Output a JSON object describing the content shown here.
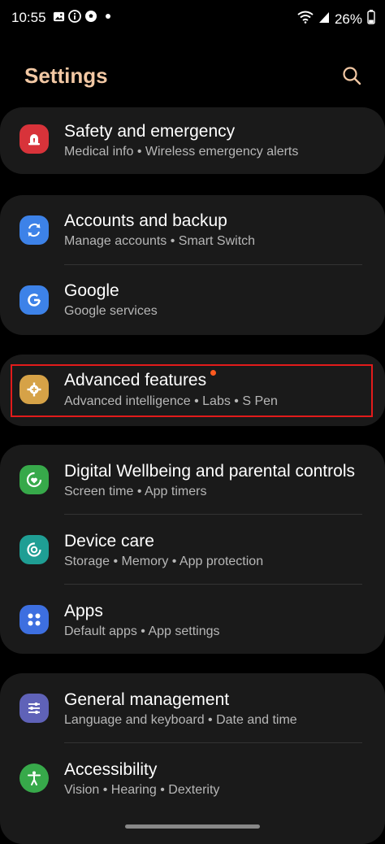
{
  "status_bar": {
    "time": "10:55",
    "battery": "26%",
    "notification_icons": [
      "gallery-icon",
      "info-icon",
      "soccer-icon"
    ]
  },
  "header": {
    "title": "Settings"
  },
  "items": [
    {
      "title": "Safety and emergency",
      "subtitle": "Medical info • Wireless emergency alerts",
      "icon": "siren-icon",
      "color": "#d8333a"
    },
    {
      "title": "Accounts and backup",
      "subtitle": "Manage accounts • Smart Switch",
      "icon": "sync-icon",
      "color": "#3d82e8"
    },
    {
      "title": "Google",
      "subtitle": "Google services",
      "icon": "google-icon",
      "color": "#3d82e8"
    },
    {
      "title": "Advanced features",
      "subtitle": "Advanced intelligence • Labs • S Pen",
      "icon": "gear-plus-icon",
      "color": "#d6a247"
    },
    {
      "title": "Digital Wellbeing and parental controls",
      "subtitle": "Screen time • App timers",
      "icon": "wellbeing-icon",
      "color": "#37a94a"
    },
    {
      "title": "Device care",
      "subtitle": "Storage • Memory • App protection",
      "icon": "device-care-icon",
      "color": "#1f9e94"
    },
    {
      "title": "Apps",
      "subtitle": "Default apps • App settings",
      "icon": "apps-icon",
      "color": "#3d6fe0"
    },
    {
      "title": "General management",
      "subtitle": "Language and keyboard • Date and time",
      "icon": "sliders-icon",
      "color": "#5f62b8"
    },
    {
      "title": "Accessibility",
      "subtitle": "Vision • Hearing • Dexterity",
      "icon": "accessibility-icon",
      "color": "#37a94a"
    }
  ]
}
